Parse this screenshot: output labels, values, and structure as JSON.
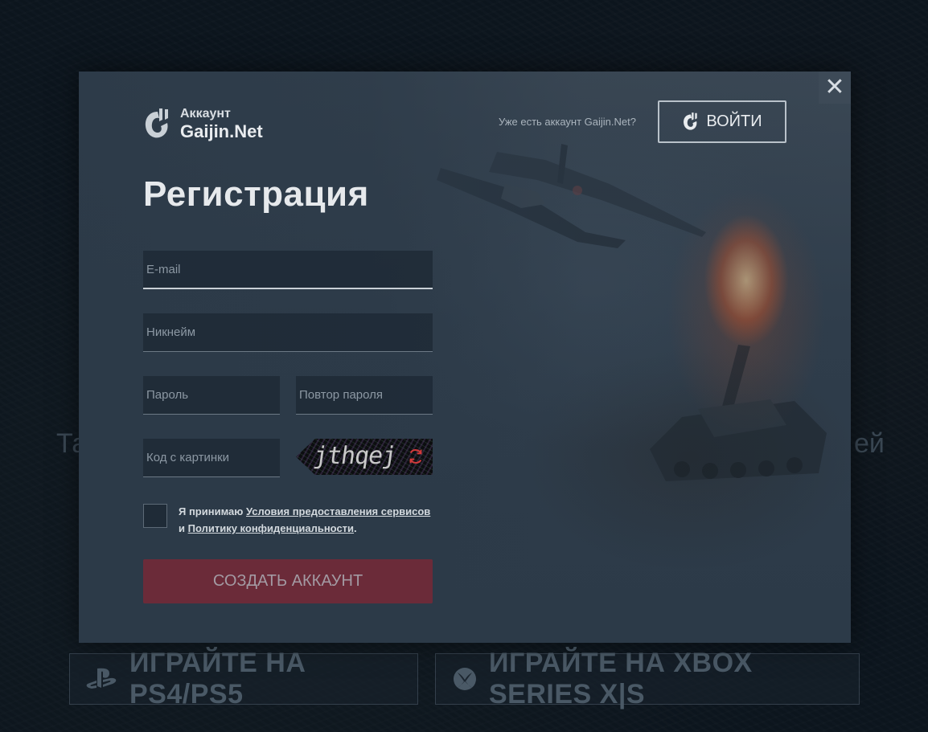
{
  "background": {
    "side_text_left": "Та",
    "side_text_right": "ей",
    "ps_button_label": "ИГРАЙТЕ НА PS4/PS5",
    "xbox_button_label": "ИГРАЙТЕ НА XBOX SERIES X|S"
  },
  "modal": {
    "close_label": "✕",
    "logo": {
      "small": "Аккаунт",
      "big": "Gaijin.Net"
    },
    "have_account_text": "Уже есть аккаунт Gaijin.Net?",
    "login_button_label": "ВОЙТИ",
    "title": "Регистрация",
    "fields": {
      "email_placeholder": "E-mail",
      "nickname_placeholder": "Никнейм",
      "password_placeholder": "Пароль",
      "password_repeat_placeholder": "Повтор пароля",
      "captcha_placeholder": "Код с картинки"
    },
    "captcha_text": "jthqej",
    "terms": {
      "prefix": "Я принимаю",
      "tos_link": "Условия предоставления сервисов",
      "middle": "и",
      "privacy_link": "Политику конфиденциальности",
      "suffix": "."
    },
    "create_button_label": "СОЗДАТЬ АККАУНТ"
  },
  "colors": {
    "accent_button": "#6b2b39",
    "modal_bg": "#2c3a48"
  }
}
